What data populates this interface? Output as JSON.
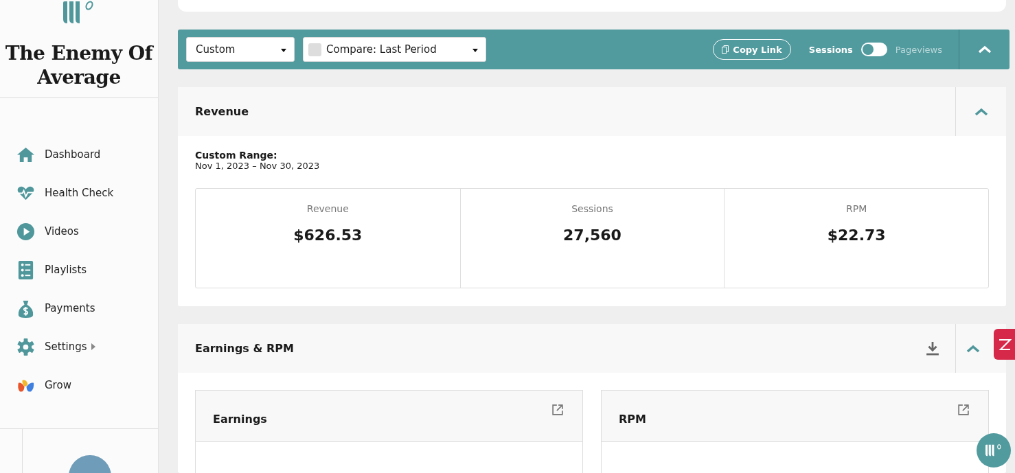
{
  "brand": {
    "title": "The Enemy Of Average"
  },
  "nav": [
    {
      "label": "Dashboard",
      "kind": "home",
      "submenu": false
    },
    {
      "label": "Health Check",
      "kind": "heart",
      "submenu": false
    },
    {
      "label": "Videos",
      "kind": "play",
      "submenu": false
    },
    {
      "label": "Playlists",
      "kind": "list",
      "submenu": false
    },
    {
      "label": "Payments",
      "kind": "money",
      "submenu": false
    },
    {
      "label": "Settings",
      "kind": "gear",
      "submenu": true
    },
    {
      "label": "Grow",
      "kind": "grow",
      "submenu": false
    }
  ],
  "filters": {
    "range": "Custom",
    "compare": "Compare: Last Period",
    "compare_checked": false,
    "copy_link": "Copy Link",
    "metric_toggle": [
      {
        "label": "Sessions",
        "selected": true
      },
      {
        "label": "Pageviews",
        "selected": false
      }
    ]
  },
  "revenue": {
    "title": "Revenue",
    "range_label": "Custom Range:",
    "range": "Nov 1, 2023 – Nov 30, 2023",
    "stats": [
      {
        "label": "Revenue",
        "value": "$626.53"
      },
      {
        "label": "Sessions",
        "value": "27,560"
      },
      {
        "label": "RPM",
        "value": "$22.73"
      }
    ]
  },
  "earnings": {
    "title": "Earnings & RPM",
    "panels": [
      {
        "title": "Earnings"
      },
      {
        "title": "RPM"
      }
    ]
  }
}
